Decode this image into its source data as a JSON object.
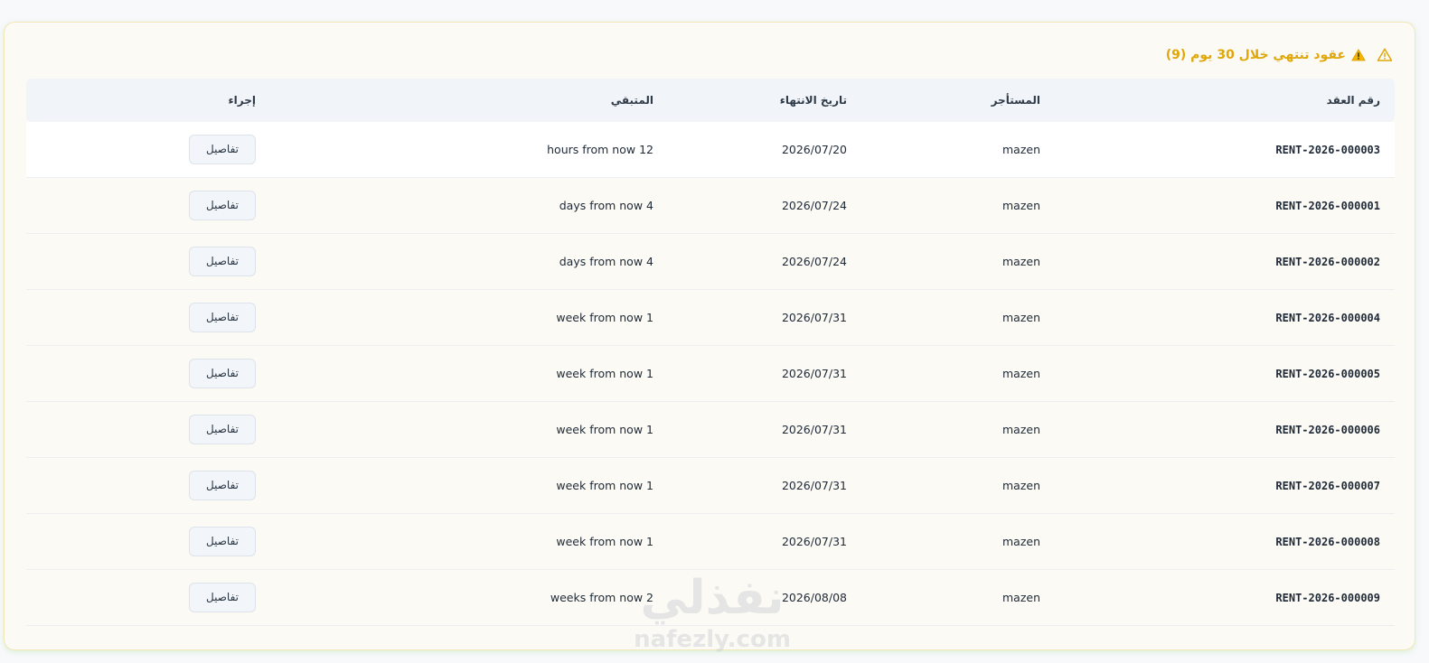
{
  "card": {
    "title": "عقود تنتهي خلال 30 يوم (9)",
    "title_color": "#e0a70a"
  },
  "table": {
    "headers": {
      "contract_no": "رقم العقد",
      "tenant": "المستأجر",
      "end_date": "تاريخ الانتهاء",
      "remaining": "المتبقي",
      "action": "إجراء"
    },
    "rows": [
      {
        "contract_no": "RENT-2026-000003",
        "tenant": "mazen",
        "end_date": "2026/07/20",
        "remaining": "12 hours from now",
        "action": "تفاصيل"
      },
      {
        "contract_no": "RENT-2026-000001",
        "tenant": "mazen",
        "end_date": "2026/07/24",
        "remaining": "4 days from now",
        "action": "تفاصيل"
      },
      {
        "contract_no": "RENT-2026-000002",
        "tenant": "mazen",
        "end_date": "2026/07/24",
        "remaining": "4 days from now",
        "action": "تفاصيل"
      },
      {
        "contract_no": "RENT-2026-000004",
        "tenant": "mazen",
        "end_date": "2026/07/31",
        "remaining": "1 week from now",
        "action": "تفاصيل"
      },
      {
        "contract_no": "RENT-2026-000005",
        "tenant": "mazen",
        "end_date": "2026/07/31",
        "remaining": "1 week from now",
        "action": "تفاصيل"
      },
      {
        "contract_no": "RENT-2026-000006",
        "tenant": "mazen",
        "end_date": "2026/07/31",
        "remaining": "1 week from now",
        "action": "تفاصيل"
      },
      {
        "contract_no": "RENT-2026-000007",
        "tenant": "mazen",
        "end_date": "2026/07/31",
        "remaining": "1 week from now",
        "action": "تفاصيل"
      },
      {
        "contract_no": "RENT-2026-000008",
        "tenant": "mazen",
        "end_date": "2026/07/31",
        "remaining": "1 week from now",
        "action": "تفاصيل"
      },
      {
        "contract_no": "RENT-2026-000009",
        "tenant": "mazen",
        "end_date": "2026/08/08",
        "remaining": "2 weeks from now",
        "action": "تفاصيل"
      }
    ]
  },
  "watermark": {
    "arabic": "نفذلي",
    "latin": "nafezly.com"
  }
}
